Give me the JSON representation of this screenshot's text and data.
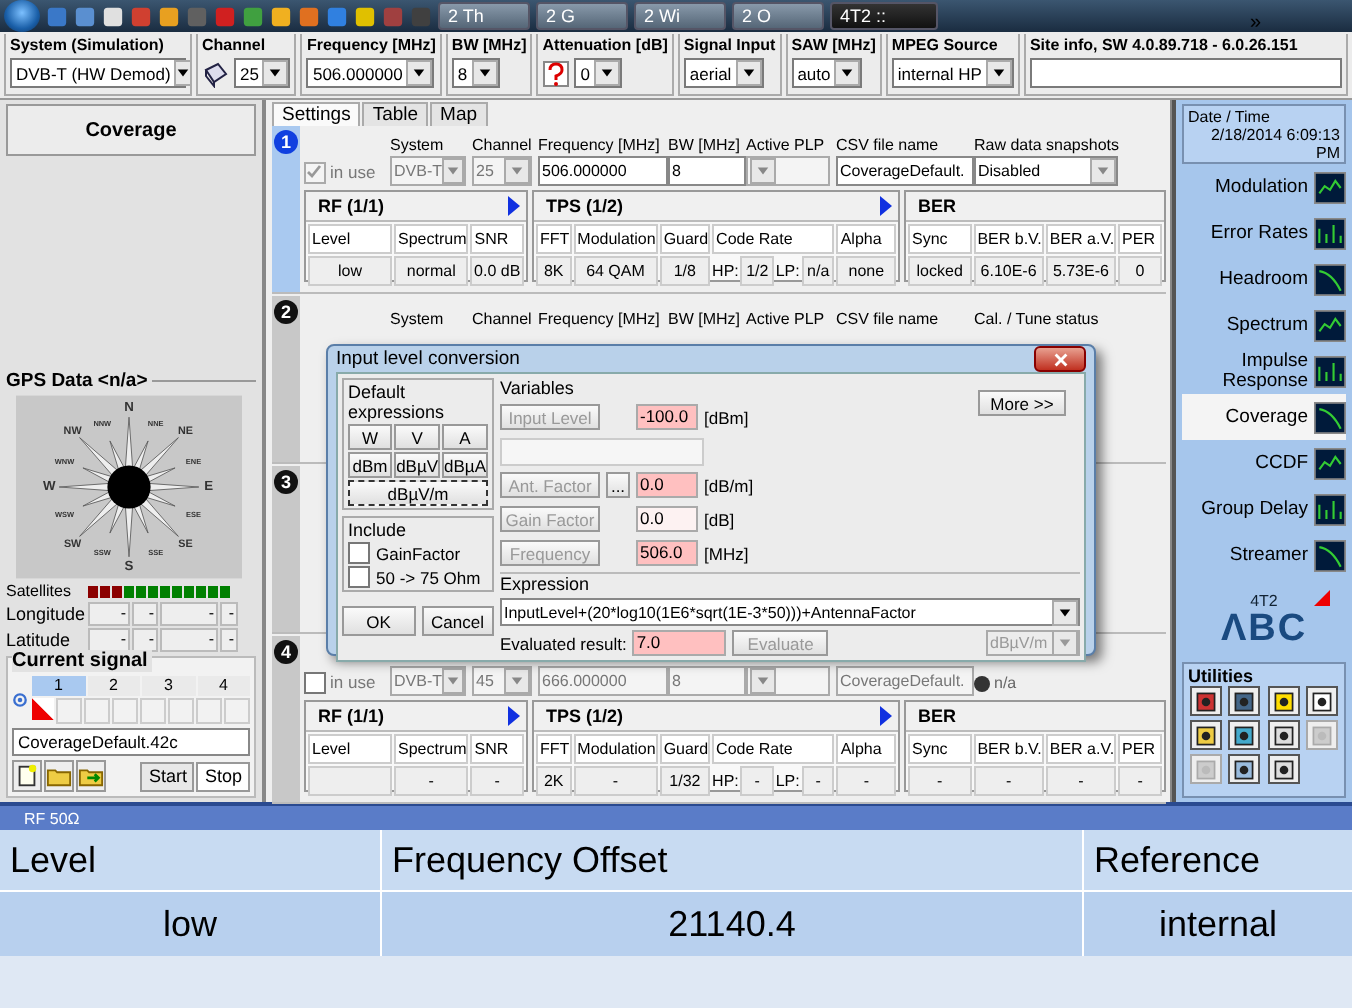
{
  "taskbar": {
    "more": "»",
    "tasks": [
      {
        "label": "2 Th",
        "selected": false
      },
      {
        "label": "2 G",
        "selected": false
      },
      {
        "label": "2 Wi",
        "selected": false
      },
      {
        "label": "2 O",
        "selected": false
      },
      {
        "label": "4T2 :: ",
        "selected": true
      }
    ]
  },
  "toolbar": [
    {
      "label": "System (Simulation)",
      "value": "DVB-T (HW Demod)",
      "kind": "select"
    },
    {
      "label": "Channel",
      "value": "25",
      "kind": "book-select"
    },
    {
      "label": "Frequency [MHz]",
      "value": "506.000000",
      "kind": "select"
    },
    {
      "label": "BW [MHz]",
      "value": "8",
      "kind": "select"
    },
    {
      "label": "Attenuation [dB]",
      "value": "0",
      "kind": "help-select"
    },
    {
      "label": "Signal Input",
      "value": "aerial",
      "kind": "select"
    },
    {
      "label": "SAW [MHz]",
      "value": "auto",
      "kind": "select"
    },
    {
      "label": "MPEG Source",
      "value": "internal HP",
      "kind": "select"
    },
    {
      "label": "Site info, SW 4.0.89.718 - 6.0.26.151",
      "kind": "field"
    }
  ],
  "left": {
    "mode_button": "Coverage",
    "gps": {
      "title": "GPS Data <n/a>",
      "compass": [
        "N",
        "NNE",
        "NE",
        "ENE",
        "E",
        "ESE",
        "SE",
        "SSE",
        "S",
        "SSW",
        "SW",
        "WSW",
        "W",
        "WNW",
        "NW",
        "NNW"
      ],
      "satellites_label": "Satellites",
      "satellites": [
        {
          "color": "#8b0000"
        },
        {
          "color": "#8b0000"
        },
        {
          "color": "#8b0000"
        },
        {
          "color": "#008000"
        },
        {
          "color": "#008000"
        },
        {
          "color": "#008000"
        },
        {
          "color": "#008000"
        },
        {
          "color": "#008000"
        },
        {
          "color": "#008000"
        },
        {
          "color": "#008000"
        },
        {
          "color": "#008000"
        },
        {
          "color": "#008000"
        }
      ],
      "coords": [
        {
          "label": "Longitude",
          "cells": [
            "-",
            "-",
            "-",
            "-"
          ]
        },
        {
          "label": "Latitude",
          "cells": [
            "-",
            "-",
            "-",
            "-"
          ]
        }
      ]
    },
    "signal": {
      "title": "Current signal",
      "tabs": [
        {
          "label": "1",
          "selected": true
        },
        {
          "label": "2",
          "selected": false
        },
        {
          "label": "3",
          "selected": false
        },
        {
          "label": "4",
          "selected": false
        }
      ],
      "file": "CoverageDefault.42c",
      "start": "Start",
      "stop": "Stop"
    }
  },
  "center": {
    "tabs": [
      {
        "label": "Settings",
        "selected": true
      },
      {
        "label": "Table",
        "selected": false
      },
      {
        "label": "Map",
        "selected": false
      }
    ],
    "channels": [
      {
        "number": "1",
        "selected": true,
        "in_use": true,
        "in_use_label": "in use",
        "settings": [
          {
            "label": "System",
            "value": "DVB-T",
            "kind": "select"
          },
          {
            "label": "Channel",
            "value": "25",
            "kind": "select"
          },
          {
            "label": "Frequency [MHz]",
            "value": "506.000000",
            "kind": "field"
          },
          {
            "label": "BW [MHz]",
            "value": "8",
            "kind": "field"
          },
          {
            "label": "Active PLP",
            "kind": "select"
          },
          {
            "label": "CSV file name",
            "value": "CoverageDefault.",
            "kind": "field"
          },
          {
            "label": "Raw data snapshots",
            "value": "Disabled",
            "kind": "select"
          }
        ],
        "rf": {
          "title": "RF (1/1)",
          "columns": [
            "Level",
            "Spectrum",
            "SNR"
          ],
          "level": "low",
          "spectrum": "normal",
          "snr": "0.0 dB"
        },
        "tps": {
          "title": "TPS (1/2)",
          "columns": [
            "FFT",
            "Modulation",
            "Guard",
            "Code Rate",
            "Alpha"
          ],
          "values": [
            "8K",
            "64 QAM",
            "1/8",
            [
              "HP:",
              "1/2",
              "LP:",
              "n/a"
            ],
            "none"
          ]
        },
        "ber": {
          "title": "BER",
          "columns": [
            "Sync",
            "BER b.V.",
            "BER a.V.",
            "PER"
          ],
          "values": [
            "locked",
            "6.10E-6",
            "5.73E-6",
            "0"
          ]
        }
      },
      {
        "number": "2",
        "selected": false,
        "settings": [
          {
            "label": "System"
          },
          {
            "label": "Channel"
          },
          {
            "label": "Frequency [MHz]"
          },
          {
            "label": "BW [MHz]"
          },
          {
            "label": "Active PLP"
          },
          {
            "label": "CSV file name"
          },
          {
            "label": "Cal. / Tune status"
          }
        ]
      },
      {
        "number": "3",
        "selected": false
      },
      {
        "number": "4",
        "selected": false,
        "in_use": false,
        "in_use_label": "in use",
        "settings": [
          {
            "value": "DVB-T",
            "kind": "select"
          },
          {
            "value": "45",
            "kind": "select"
          },
          {
            "value": "666.000000",
            "kind": "field"
          },
          {
            "value": "8",
            "kind": "field"
          },
          {
            "kind": "select"
          },
          {
            "value": "CoverageDefault.",
            "kind": "field"
          },
          {
            "value": "n/a",
            "kind": "status"
          }
        ],
        "rf": {
          "title": "RF (1/1)",
          "columns": [
            "Level",
            "Spectrum",
            "SNR"
          ],
          "spectrum": "-",
          "snr": "-"
        },
        "tps": {
          "title": "TPS (1/2)",
          "columns": [
            "FFT",
            "Modulation",
            "Guard",
            "Code Rate",
            "Alpha"
          ],
          "values": [
            "2K",
            "-",
            "1/32",
            [
              "HP:",
              "-",
              "LP:",
              "-"
            ],
            "-"
          ]
        },
        "ber": {
          "title": "BER",
          "columns": [
            "Sync",
            "BER b.V.",
            "BER a.V.",
            "PER"
          ],
          "values": [
            "-",
            "-",
            "-",
            "-"
          ]
        }
      }
    ]
  },
  "dialog": {
    "title": "Input level conversion",
    "default_expressions": {
      "title": "Default expressions",
      "buttons": [
        {
          "label": "W",
          "focused": false
        },
        {
          "label": "V",
          "focused": false
        },
        {
          "label": "A",
          "focused": false
        },
        {
          "label": "dBm",
          "focused": false
        },
        {
          "label": "dBµV",
          "focused": false
        },
        {
          "label": "dBµA",
          "focused": false
        },
        {
          "label": "dBµV/m",
          "focused": true
        }
      ]
    },
    "include": {
      "title": "Include",
      "options": [
        {
          "label": "GainFactor",
          "checked": false
        },
        {
          "label": "50 -> 75 Ohm",
          "checked": false
        }
      ]
    },
    "ok": "OK",
    "cancel": "Cancel",
    "variables": {
      "title": "Variables",
      "more": "More >>",
      "rows": [
        {
          "kind": "var",
          "button": "Input Level",
          "value": "-100.0",
          "unit": "[dBm]",
          "highlighted": true
        },
        {
          "kind": "blank"
        },
        {
          "kind": "var",
          "button": "Ant. Factor",
          "browse": "...",
          "value": "0.0",
          "unit": "[dB/m]",
          "highlighted": true
        },
        {
          "kind": "var",
          "button": "Gain Factor",
          "value": "0.0",
          "unit": "[dB]",
          "highlighted": false
        },
        {
          "kind": "var",
          "button": "Frequency",
          "value": "506.0",
          "unit": "[MHz]",
          "highlighted": true
        }
      ]
    },
    "expression": {
      "title": "Expression",
      "value": "InputLevel+(20*log10(1E6*sqrt(1E-3*50)))+AntennaFactor",
      "result_label": "Evaluated result:",
      "result": "7.0",
      "evaluate": "Evaluate",
      "unit": "dBµV/m"
    }
  },
  "right": {
    "date_title": "Date / Time",
    "date": "2/18/2014 6:09:13 PM",
    "nav": [
      {
        "label": "Modulation",
        "selected": false
      },
      {
        "label": "Error Rates",
        "selected": false
      },
      {
        "label": "Headroom",
        "selected": false
      },
      {
        "label": "Spectrum",
        "selected": false
      },
      {
        "label": "Impulse Response",
        "selected": false
      },
      {
        "label": "Coverage",
        "selected": true
      },
      {
        "label": "CCDF",
        "selected": false
      },
      {
        "label": "Group Delay",
        "selected": false
      },
      {
        "label": "Streamer",
        "selected": false
      }
    ],
    "logo_top": "4T2",
    "logo": "ΛBC",
    "utilities_title": "Utilities",
    "utilities": [
      {
        "disabled": false
      },
      {
        "disabled": false
      },
      {
        "disabled": false
      },
      {
        "disabled": false
      },
      {
        "disabled": false
      },
      {
        "disabled": false
      },
      {
        "disabled": false
      },
      {
        "disabled": true
      },
      {
        "disabled": true
      },
      {
        "disabled": false
      },
      {
        "disabled": false
      }
    ]
  },
  "bottom": {
    "label": "RF 50Ω",
    "columns": [
      "Level",
      "Frequency Offset",
      "Reference"
    ],
    "values": [
      "low",
      "21140.4",
      "internal"
    ]
  }
}
